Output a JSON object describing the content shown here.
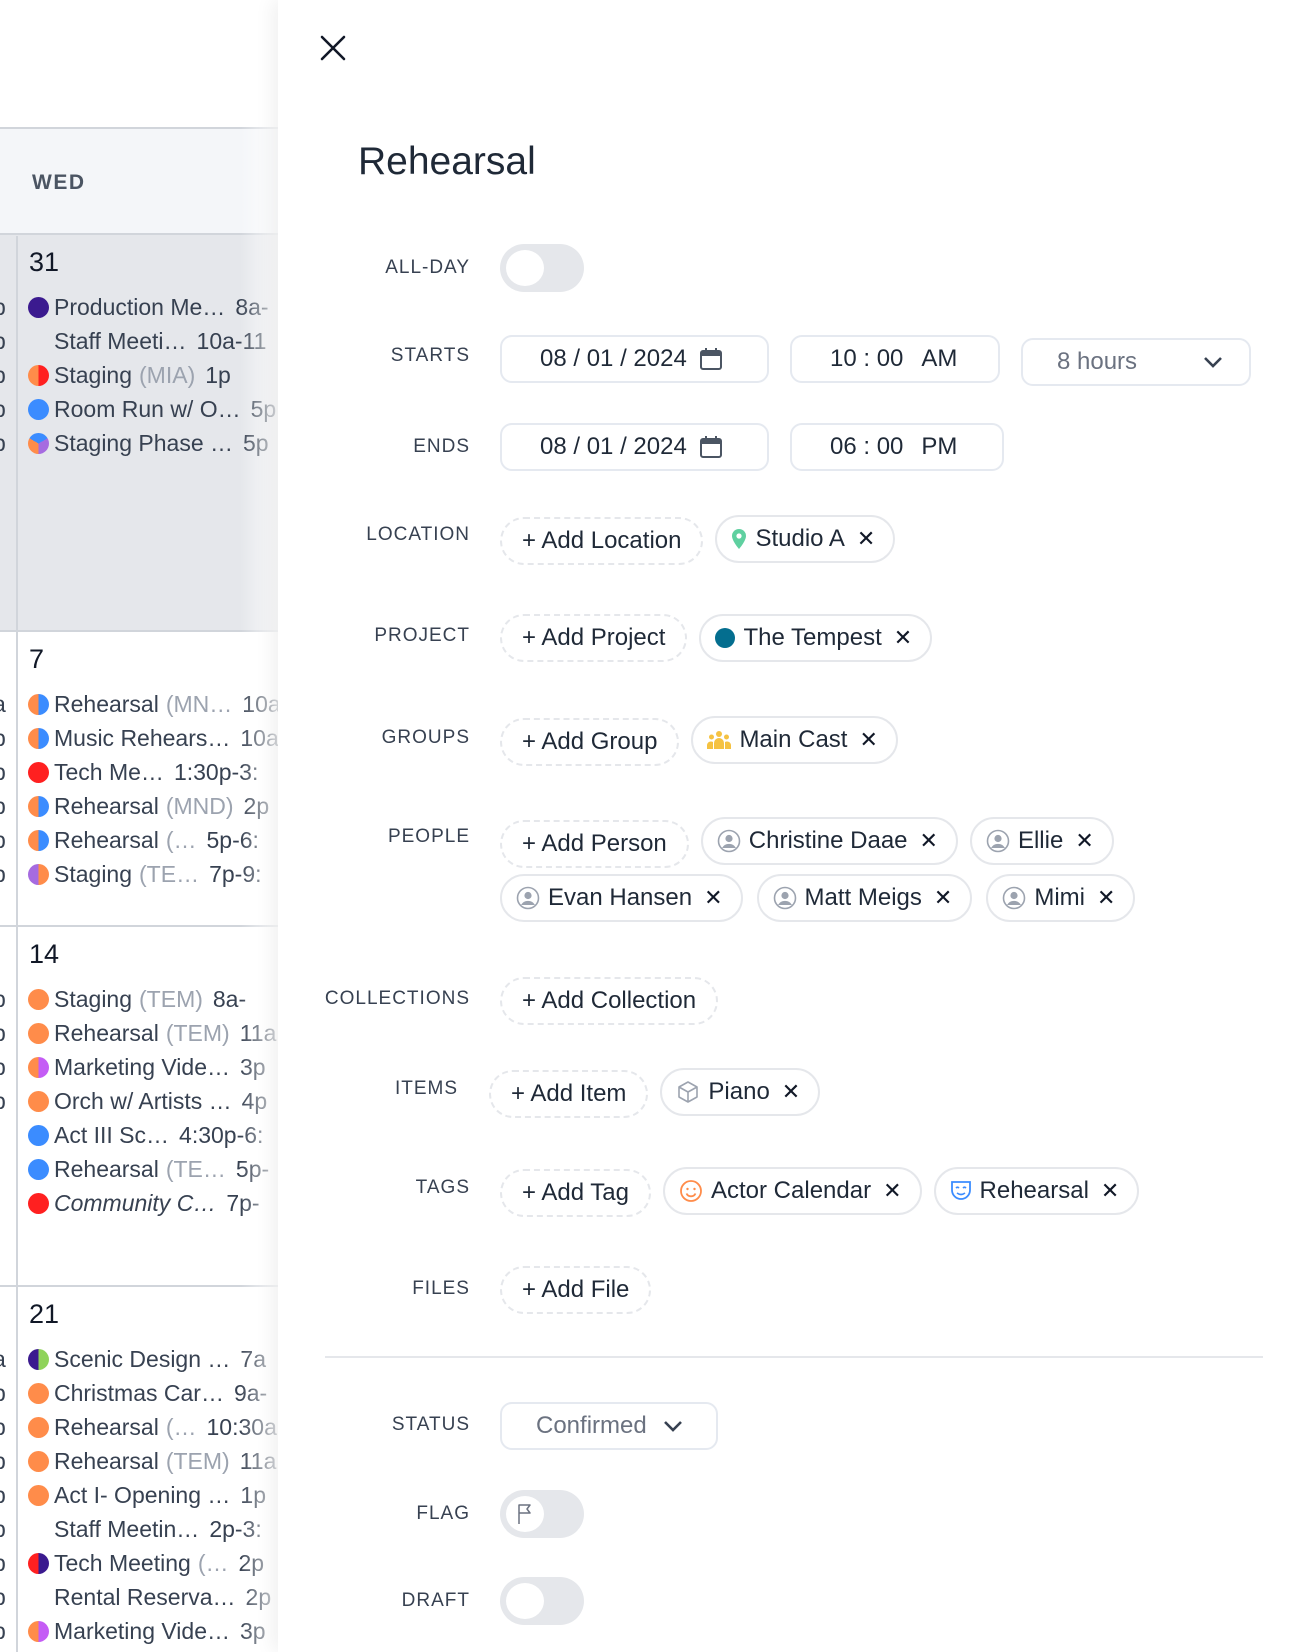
{
  "calendar": {
    "day_header": "WED",
    "weeks": [
      {
        "day": "31",
        "shaded": true,
        "fragments": [
          "p",
          "p",
          "p",
          "p",
          "p"
        ],
        "events": [
          {
            "name": "Production Me…",
            "paren": "",
            "time": "8a-",
            "colors": [
              "#3b1a8f"
            ]
          },
          {
            "name": "Staff Meeti…",
            "paren": "",
            "time": "10a-11",
            "colors": []
          },
          {
            "name": "Staging",
            "paren": "(MIA)",
            "time": "1p",
            "colors": [
              "#ff8c4a",
              "#ff2020"
            ]
          },
          {
            "name": "Room Run w/ O…",
            "paren": "",
            "time": "5p",
            "colors": [
              "#3b8cff"
            ]
          },
          {
            "name": "Staging Phase …",
            "paren": "",
            "time": "5p",
            "colors": [
              "#3b8cff",
              "#a66be0",
              "#ff8c4a"
            ]
          }
        ]
      },
      {
        "day": "7",
        "shaded": false,
        "fragments": [
          "a",
          "p",
          "p",
          "p",
          "p",
          "p"
        ],
        "events": [
          {
            "name": "Rehearsal",
            "paren": "(MN…",
            "time": "10a",
            "colors": [
              "#ff8c4a",
              "#3b8cff"
            ]
          },
          {
            "name": "Music Rehears…",
            "paren": "",
            "time": "10a",
            "colors": [
              "#ff8c4a",
              "#3b8cff"
            ]
          },
          {
            "name": "Tech Me…",
            "paren": "",
            "time": "1:30p-3:",
            "colors": [
              "#ff2020"
            ]
          },
          {
            "name": "Rehearsal",
            "paren": "(MND)",
            "time": "2p",
            "colors": [
              "#ff8c4a",
              "#3b8cff"
            ]
          },
          {
            "name": "Rehearsal",
            "paren": "(…",
            "time": "5p-6:",
            "colors": [
              "#ff8c4a",
              "#3b8cff"
            ]
          },
          {
            "name": "Staging",
            "paren": "(TE…",
            "time": "7p-9:",
            "colors": [
              "#a66be0",
              "#ff8c4a"
            ]
          }
        ]
      },
      {
        "day": "14",
        "shaded": false,
        "fragments": [
          "p",
          "p",
          "p",
          "p"
        ],
        "events": [
          {
            "name": "Staging",
            "paren": "(TEM)",
            "time": "8a-",
            "colors": [
              "#ff8c4a"
            ]
          },
          {
            "name": "Rehearsal",
            "paren": "(TEM)",
            "time": "11a",
            "colors": [
              "#ff8c4a"
            ]
          },
          {
            "name": "Marketing Vide…",
            "paren": "",
            "time": "3p",
            "colors": [
              "#ff8c4a",
              "#c45cf5"
            ]
          },
          {
            "name": "Orch w/ Artists …",
            "paren": "",
            "time": "4p",
            "colors": [
              "#ff8c4a"
            ]
          },
          {
            "name": "Act III Sc…",
            "paren": "",
            "time": "4:30p-6:",
            "colors": [
              "#3b8cff"
            ]
          },
          {
            "name": "Rehearsal",
            "paren": "(TE…",
            "time": "5p-",
            "colors": [
              "#3b8cff"
            ]
          },
          {
            "name": "Community C…",
            "paren": "",
            "time": "7p-",
            "colors": [
              "#ff2020"
            ],
            "italic": true
          }
        ]
      },
      {
        "day": "21",
        "shaded": false,
        "fragments": [
          "a",
          "p",
          "p",
          "p",
          "p",
          "p",
          "p",
          "p",
          "p"
        ],
        "events": [
          {
            "name": "Scenic Design …",
            "paren": "",
            "time": "7a",
            "colors": [
              "#3b1a8f",
              "#8fd35a"
            ]
          },
          {
            "name": "Christmas Car…",
            "paren": "",
            "time": "9a-",
            "colors": [
              "#ff8c4a"
            ]
          },
          {
            "name": "Rehearsal",
            "paren": "(…",
            "time": "10:30a",
            "colors": [
              "#ff8c4a"
            ]
          },
          {
            "name": "Rehearsal",
            "paren": "(TEM)",
            "time": "11a",
            "colors": [
              "#ff8c4a"
            ]
          },
          {
            "name": "Act I- Opening …",
            "paren": "",
            "time": "1p",
            "colors": [
              "#ff8c4a"
            ]
          },
          {
            "name": "Staff Meetin…",
            "paren": "",
            "time": "2p-3:",
            "colors": []
          },
          {
            "name": "Tech Meeting",
            "paren": "(…",
            "time": "2p",
            "colors": [
              "#ff2020",
              "#3b1a8f"
            ]
          },
          {
            "name": "Rental Reserva…",
            "paren": "",
            "time": "2p",
            "colors": []
          },
          {
            "name": "Marketing Vide…",
            "paren": "",
            "time": "3p",
            "colors": [
              "#ff8c4a",
              "#c45cf5"
            ]
          }
        ]
      }
    ]
  },
  "panel": {
    "title": "Rehearsal",
    "labels": {
      "all_day": "ALL-DAY",
      "starts": "STARTS",
      "ends": "ENDS",
      "location": "LOCATION",
      "project": "PROJECT",
      "groups": "GROUPS",
      "people": "PEOPLE",
      "collections": "COLLECTIONS",
      "items": "ITEMS",
      "tags": "TAGS",
      "files": "FILES",
      "status": "STATUS",
      "flag": "FLAG",
      "draft": "DRAFT"
    },
    "all_day": false,
    "starts": {
      "date": "08 / 01 / 2024",
      "time": "10 : 00",
      "ampm": "AM",
      "duration": "8 hours"
    },
    "ends": {
      "date": "08 / 01 / 2024",
      "time": "06 : 00",
      "ampm": "PM"
    },
    "location": {
      "add": "+ Add Location",
      "value": "Studio A",
      "icon": "map-pin-icon",
      "icon_color": "#5fd0a0"
    },
    "project": {
      "add": "+ Add Project",
      "value": "The Tempest",
      "color": "#046e8f"
    },
    "groups": {
      "add": "+ Add Group",
      "value": "Main Cast",
      "icon": "group-icon",
      "icon_color": "#f5c242"
    },
    "people": {
      "add": "+ Add Person",
      "values": [
        "Christine Daae",
        "Ellie",
        "Evan Hansen",
        "Matt Meigs",
        "Mimi"
      ]
    },
    "collections": {
      "add": "+ Add Collection"
    },
    "items": {
      "add": "+ Add Item",
      "value": "Piano",
      "icon": "box-icon"
    },
    "tags": {
      "add": "+ Add Tag",
      "values": [
        {
          "label": "Actor Calendar",
          "icon": "smiley-icon",
          "color": "#ff8c4a"
        },
        {
          "label": "Rehearsal",
          "icon": "theater-mask-icon",
          "color": "#3b8cff"
        }
      ]
    },
    "files": {
      "add": "+ Add File"
    },
    "status": {
      "value": "Confirmed"
    },
    "flag": false,
    "draft": false,
    "remove_glyph": "✕"
  }
}
